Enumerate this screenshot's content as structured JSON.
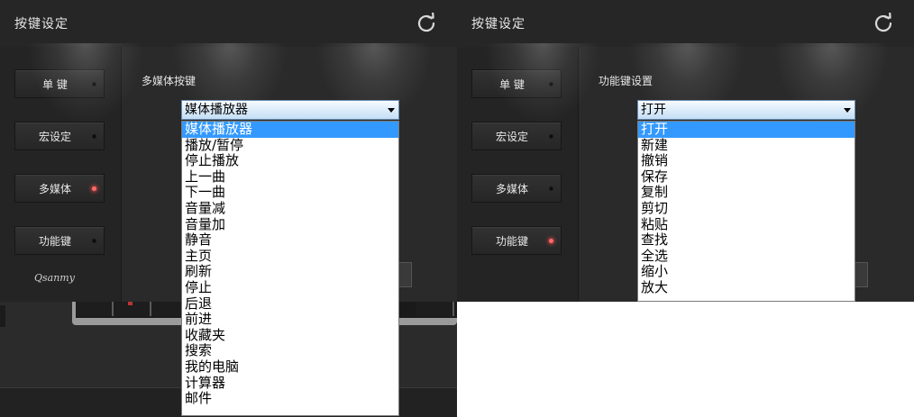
{
  "left_panel": {
    "title": "按键设定",
    "sidebar": {
      "buttons": [
        {
          "label": "单 键",
          "led": "off"
        },
        {
          "label": "宏设定",
          "led": "off"
        },
        {
          "label": "多媒体",
          "led": "on"
        },
        {
          "label": "功能键",
          "led": "off"
        }
      ],
      "logo": "Qsanmy"
    },
    "section_label": "多媒体按键",
    "select": {
      "value": "媒体播放器",
      "options": [
        "媒体播放器",
        "播放/暂停",
        "停止播放",
        "上一曲",
        "下一曲",
        "音量减",
        "音量加",
        "静音",
        "主页",
        "刷新",
        "停止",
        "后退",
        "前进",
        "收藏夹",
        "搜索",
        "我的电脑",
        "计算器",
        "邮件"
      ],
      "selected_index": 0
    }
  },
  "right_panel": {
    "title": "按键设定",
    "sidebar": {
      "buttons": [
        {
          "label": "单 键",
          "led": "off"
        },
        {
          "label": "宏设定",
          "led": "off"
        },
        {
          "label": "多媒体",
          "led": "off"
        },
        {
          "label": "功能键",
          "led": "on"
        }
      ]
    },
    "section_label": "功能键设置",
    "select": {
      "value": "打开",
      "options": [
        "打开",
        "新建",
        "撤销",
        "保存",
        "复制",
        "剪切",
        "粘贴",
        "查找",
        "全选",
        "缩小",
        "放大"
      ],
      "selected_index": 0
    }
  },
  "icons": {
    "refresh": "refresh-icon",
    "dropdown_arrow": "chevron-down-icon",
    "led": "led-indicator"
  },
  "colors": {
    "selection": "#3399ff",
    "led_on": "#ff6a6a",
    "panel_bg": "#2a2a2a"
  }
}
